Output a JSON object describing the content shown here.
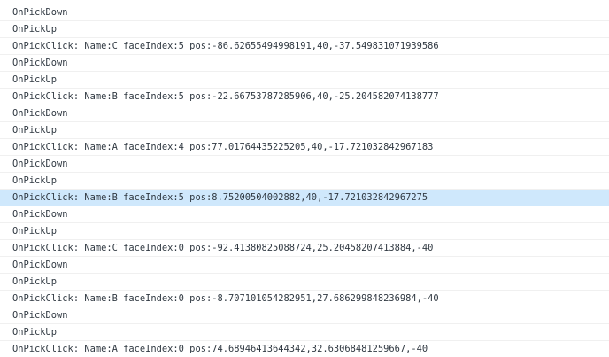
{
  "console": {
    "lines": [
      "OnPickDown",
      "OnPickUp",
      "OnPickClick: Name:C faceIndex:5 pos:-86.62655494998191,40,-37.549831071939586",
      "OnPickDown",
      "OnPickUp",
      "OnPickClick: Name:B faceIndex:5 pos:-22.66753787285906,40,-25.204582074138777",
      "OnPickDown",
      "OnPickUp",
      "OnPickClick: Name:A faceIndex:4 pos:77.01764435225205,40,-17.721032842967183",
      "OnPickDown",
      "OnPickUp",
      "OnPickClick: Name:B faceIndex:5 pos:8.75200504002882,40,-17.721032842967275",
      "OnPickDown",
      "OnPickUp",
      "OnPickClick: Name:C faceIndex:0 pos:-92.41380825088724,25.20458207413884,-40",
      "OnPickDown",
      "OnPickUp",
      "OnPickClick: Name:B faceIndex:0 pos:-8.707101054282951,27.686299848236984,-40",
      "OnPickDown",
      "OnPickUp",
      "OnPickClick: Name:A faceIndex:0 pos:74.68946413644342,32.63068481259667,-40"
    ],
    "selected_line_index": 11,
    "colors": {
      "text": "#303942",
      "selected_background": "#cfe8fc",
      "divider": "#f0f0f0"
    }
  }
}
